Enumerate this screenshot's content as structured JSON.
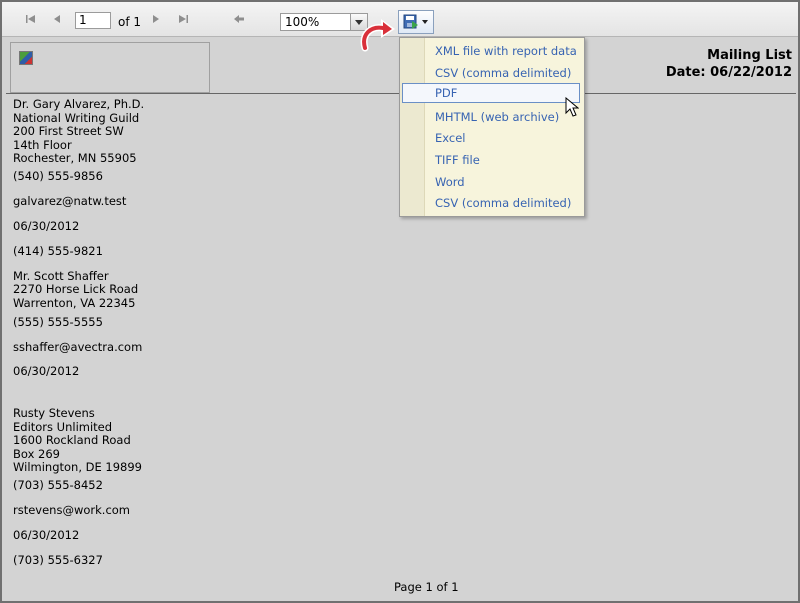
{
  "toolbar": {
    "page_current": "1",
    "page_of": "of 1",
    "zoom": "100%"
  },
  "icons": {
    "first": "first-page-icon",
    "prev": "previous-page-icon",
    "next": "next-page-icon",
    "last": "last-page-icon",
    "back": "back-to-parent-icon",
    "export": "save-export-icon"
  },
  "report": {
    "title": "Mailing List",
    "date": "Date: 06/22/2012",
    "footer": "Page 1 of 1",
    "lines": [
      "Dr. Gary Alvarez, Ph.D.",
      "National Writing Guild",
      "200 First Street SW",
      "14th Floor",
      "Rochester, MN 55905",
      "(540) 555-9856",
      "galvarez@natw.test",
      "06/30/2012",
      "(414) 555-9821",
      "Mr. Scott Shaffer",
      "2270 Horse Lick Road",
      "Warrenton, VA 22345",
      "(555) 555-5555",
      "sshaffer@avectra.com",
      "06/30/2012",
      "Rusty Stevens",
      "Editors Unlimited",
      "1600 Rockland Road",
      "Box 269",
      "Wilmington, DE 19899",
      "(703) 555-8452",
      "rstevens@work.com",
      "06/30/2012",
      "(703) 555-6327"
    ]
  },
  "export_menu": {
    "items": [
      "XML file with report data",
      "CSV (comma delimited)",
      "PDF",
      "MHTML (web archive)",
      "Excel",
      "TIFF file",
      "Word",
      "CSV (comma delimited)"
    ],
    "highlighted": "PDF"
  },
  "colors": {
    "menu_text": "#3763b2",
    "callout_red": "#d9303a",
    "report_bg": "#d3d3d3"
  }
}
